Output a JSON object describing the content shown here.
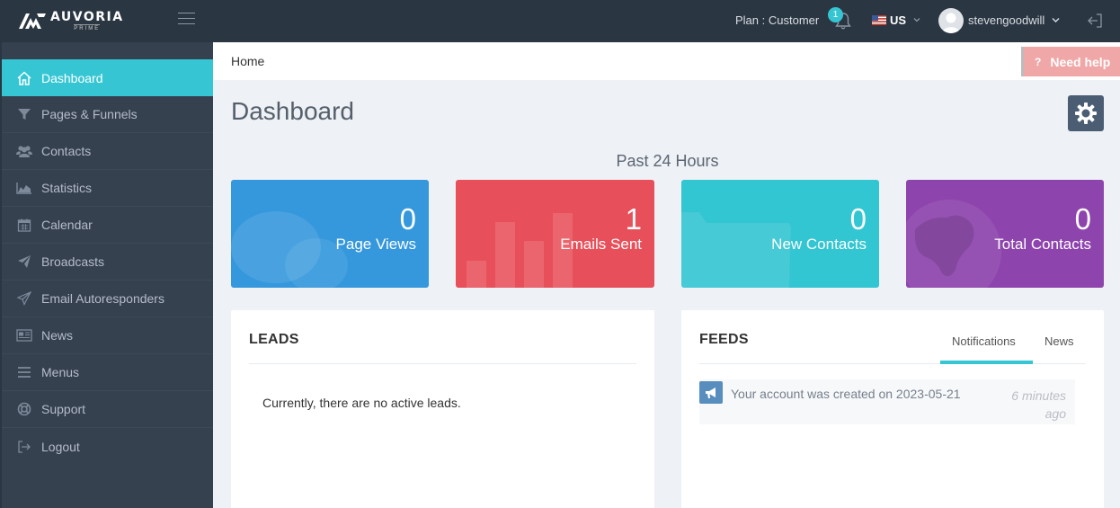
{
  "brand": {
    "name": "AUVORIA",
    "sub": "PRIME"
  },
  "topbar": {
    "plan_text": "Plan : Customer",
    "notification_count": "1",
    "language": "US",
    "username": "stevengoodwill"
  },
  "sidebar": {
    "items": [
      {
        "label": "Dashboard",
        "icon": "home-icon",
        "active": true
      },
      {
        "label": "Pages & Funnels",
        "icon": "funnel-icon"
      },
      {
        "label": "Contacts",
        "icon": "users-icon"
      },
      {
        "label": "Statistics",
        "icon": "area-chart-icon"
      },
      {
        "label": "Calendar",
        "icon": "calendar-icon"
      },
      {
        "label": "Broadcasts",
        "icon": "paper-plane-icon"
      },
      {
        "label": "Email Autoresponders",
        "icon": "paper-plane-outline-icon"
      },
      {
        "label": "News",
        "icon": "newspaper-icon"
      },
      {
        "label": "Menus",
        "icon": "bars-icon"
      },
      {
        "label": "Support",
        "icon": "life-ring-icon"
      },
      {
        "label": "Logout",
        "icon": "sign-out-icon"
      }
    ]
  },
  "breadcrumb": {
    "home": "Home"
  },
  "help": {
    "label": "Need help"
  },
  "page": {
    "title": "Dashboard",
    "period": "Past 24 Hours"
  },
  "stats": [
    {
      "value": "0",
      "label": "Page Views",
      "color": "#3598dc"
    },
    {
      "value": "1",
      "label": "Emails Sent",
      "color": "#e7505a"
    },
    {
      "value": "0",
      "label": "New Contacts",
      "color": "#32c5d2"
    },
    {
      "value": "0",
      "label": "Total Contacts",
      "color": "#8e44ad"
    }
  ],
  "leads": {
    "title": "LEADS",
    "empty_message": "Currently, there are no active leads."
  },
  "feeds": {
    "title": "FEEDS",
    "tabs": [
      {
        "label": "Notifications",
        "active": true
      },
      {
        "label": "News"
      }
    ],
    "items": [
      {
        "text": "Your account was created on 2023-05-21",
        "time": "6 minutes ago"
      }
    ]
  },
  "colors": {
    "accent": "#36c6d3",
    "sidebar": "#364150",
    "topbar": "#2b3643"
  }
}
